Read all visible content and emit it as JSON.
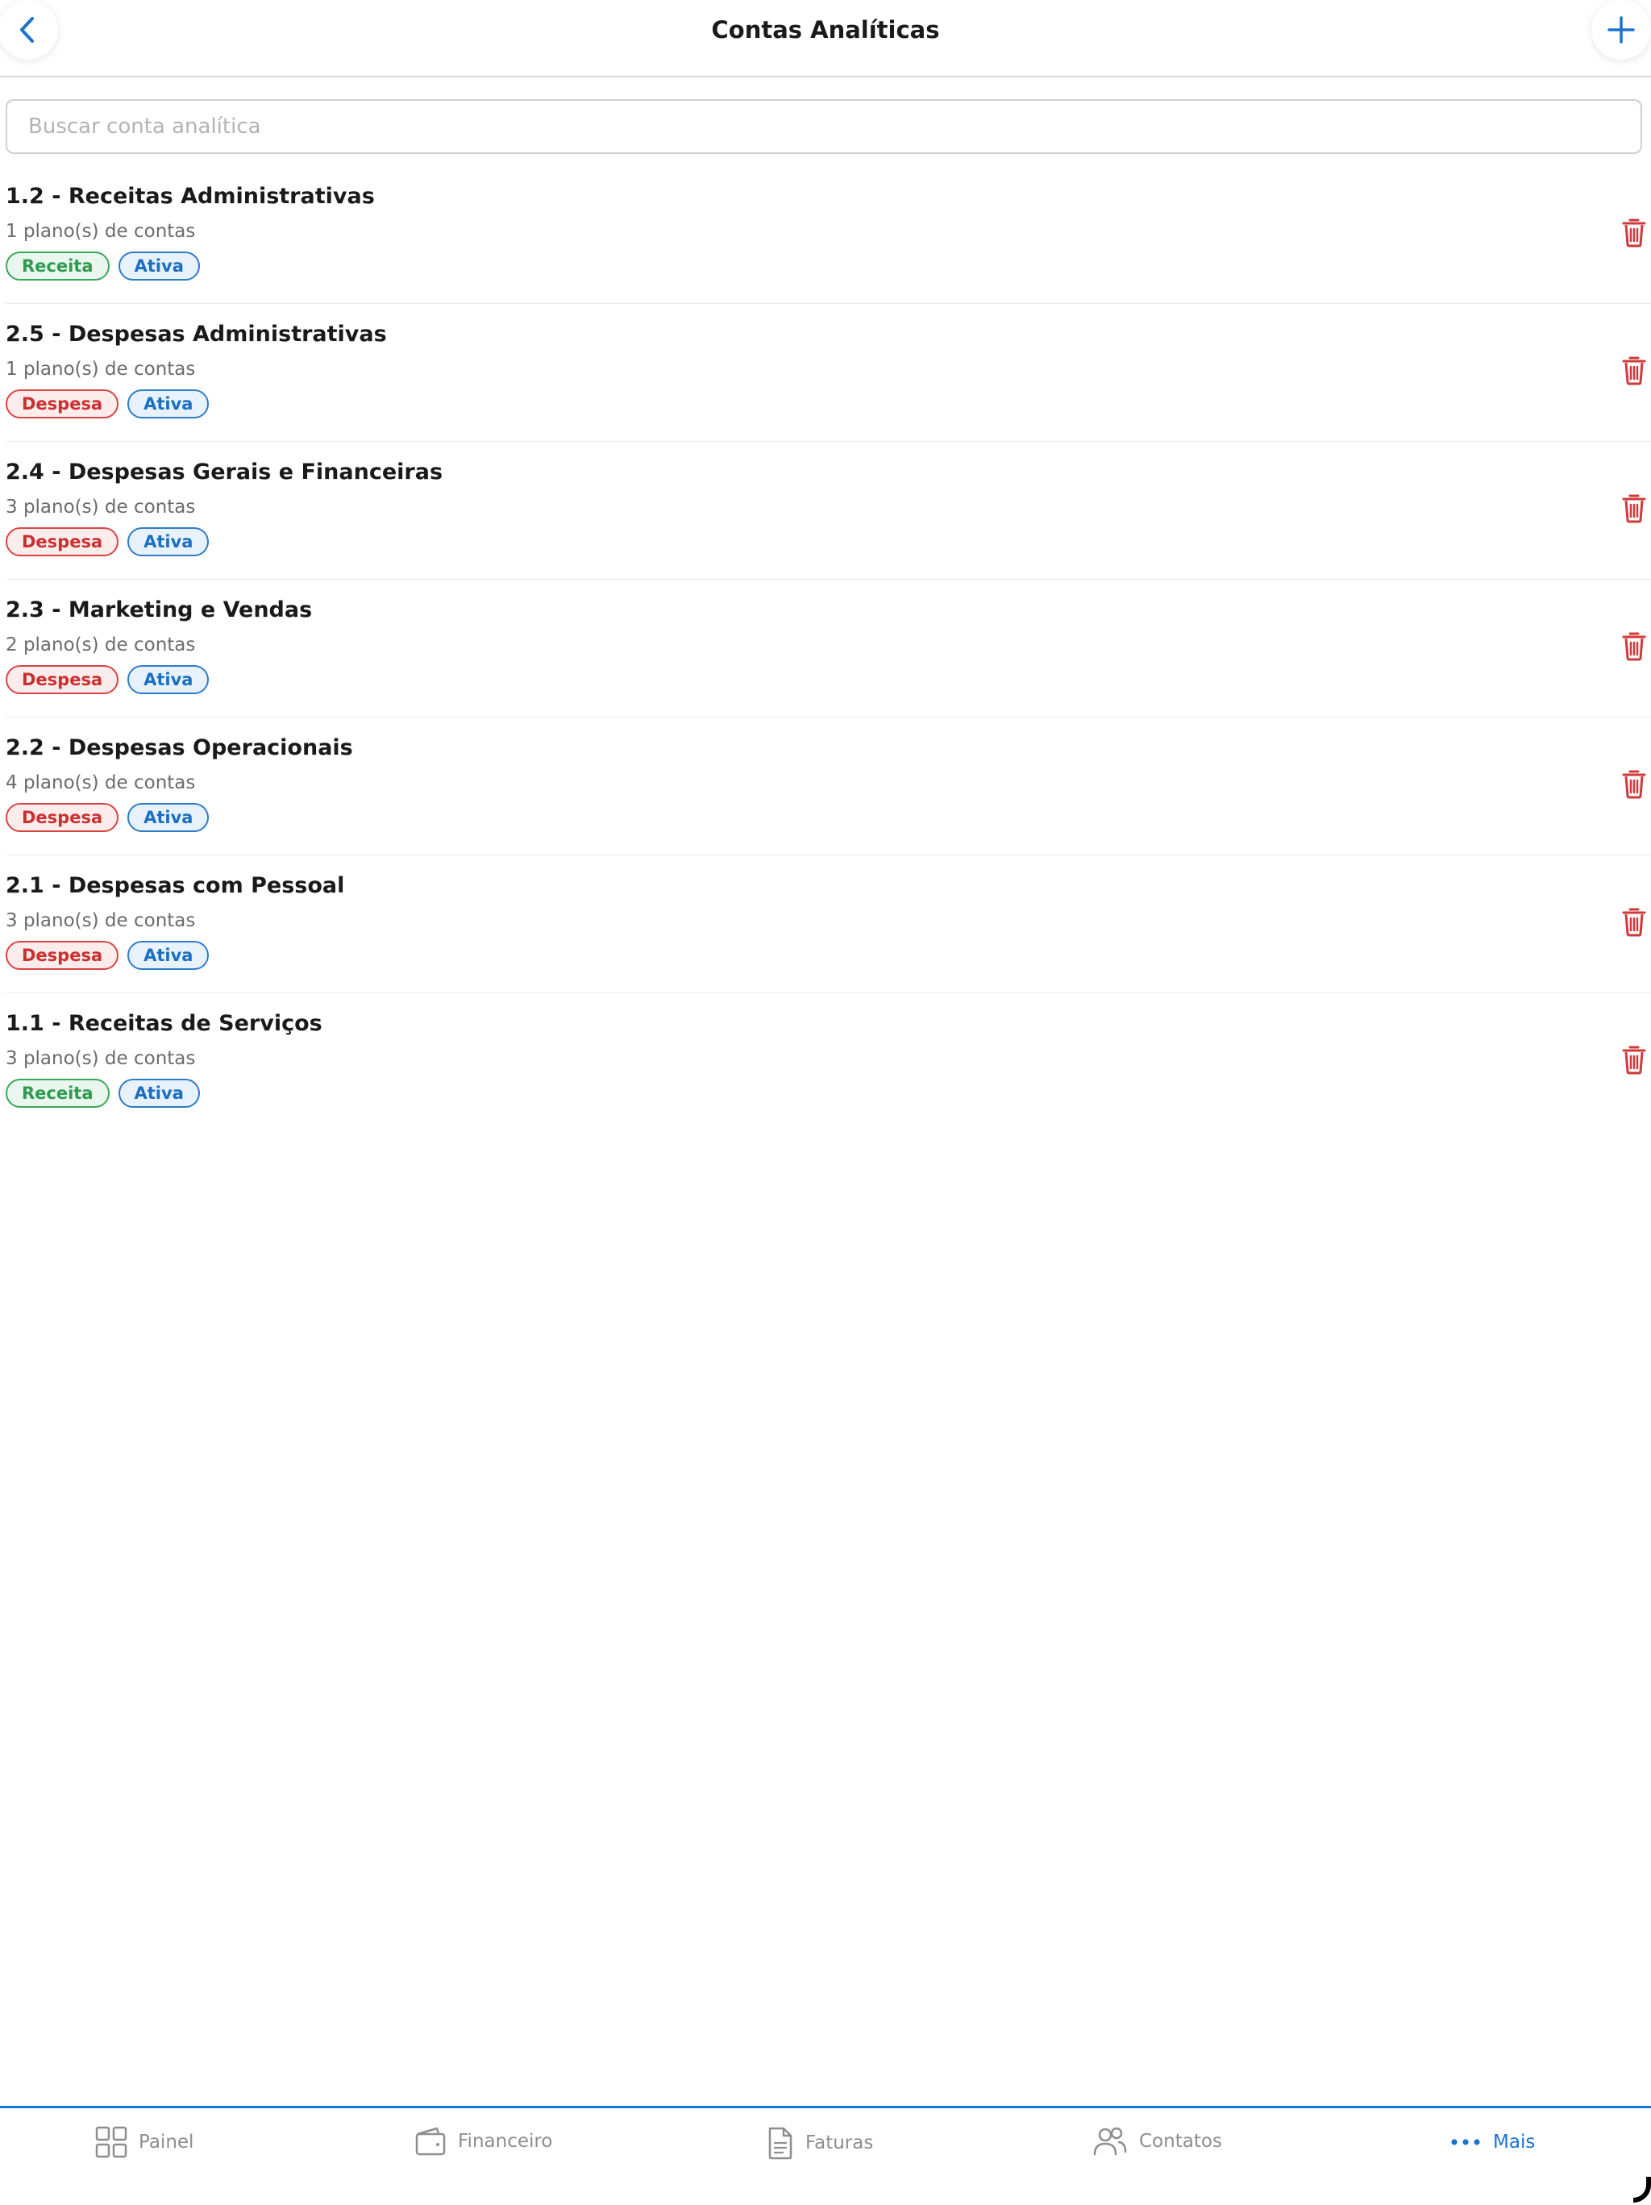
{
  "header": {
    "title": "Contas Analíticas"
  },
  "search": {
    "placeholder": "Buscar conta analítica",
    "value": ""
  },
  "items": [
    {
      "title": "1.2 - Receitas Administrativas",
      "subtitle": "1 plano(s) de contas",
      "type": "Receita",
      "status": "Ativa"
    },
    {
      "title": "2.5 - Despesas Administrativas",
      "subtitle": "1 plano(s) de contas",
      "type": "Despesa",
      "status": "Ativa"
    },
    {
      "title": "2.4 - Despesas Gerais e Financeiras",
      "subtitle": "3 plano(s) de contas",
      "type": "Despesa",
      "status": "Ativa"
    },
    {
      "title": "2.3 - Marketing e Vendas",
      "subtitle": "2 plano(s) de contas",
      "type": "Despesa",
      "status": "Ativa"
    },
    {
      "title": "2.2 - Despesas Operacionais",
      "subtitle": "4 plano(s) de contas",
      "type": "Despesa",
      "status": "Ativa"
    },
    {
      "title": "2.1 - Despesas com Pessoal",
      "subtitle": "3 plano(s) de contas",
      "type": "Despesa",
      "status": "Ativa"
    },
    {
      "title": "1.1 - Receitas de Serviços",
      "subtitle": "3 plano(s) de contas",
      "type": "Receita",
      "status": "Ativa"
    }
  ],
  "tabbar": {
    "painel": "Painel",
    "financeiro": "Financeiro",
    "faturas": "Faturas",
    "contatos": "Contatos",
    "mais": "Mais",
    "active": "mais"
  },
  "colors": {
    "accent": "#1a73d1",
    "receita": "#2e9b4f",
    "despesa": "#cc2f2f",
    "ativa": "#1a6fc2",
    "trash": "#d03a3a"
  }
}
